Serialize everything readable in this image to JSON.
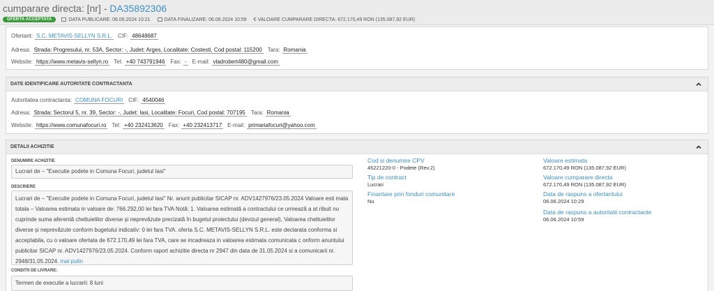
{
  "header": {
    "title_prefix": "cumparare directa: [nr] - ",
    "title_id": "DA35892306",
    "status_badge": "OFERTA ACCEPTATA",
    "publish_date": "DATA PUBLICARE: 06.06.2024 10:21",
    "finalize_date": "DATA FINALIZARE: 06.06.2024 10:59",
    "direct_value": "€ VALOARE CUMPARARE DIRECTA: 672.170,49  RON (135.087,92  EUR)"
  },
  "ofertant": {
    "name_label": "Ofertant:",
    "name": "S.C. METAVIS-SELLYN S.R.L.",
    "cif_label": "CIF:",
    "cif": "48648687",
    "address_label": "Adresa:",
    "address": "Strada: Progresului, nr. 53A, Sector: -, Judet: Arges, Localitate: Costesti, Cod postal: 115200",
    "country_label": "Tara:",
    "country": "Romania",
    "website_label": "Website:",
    "website": "https://www.metavis-sellyn.ro",
    "tel_label": "Tel:",
    "tel": "+40 743791946",
    "fax_label": "Fax:",
    "fax": "-",
    "email_label": "E-mail:",
    "email": "vladrobert480@gmail.com"
  },
  "autoritate": {
    "section_title": "DATE IDENTIFICARE AUTORITATE CONTRACTANTA",
    "name_label": "Autoritatea contractanta:",
    "name": "COMUNA FOCURI",
    "cif_label": "CIF:",
    "cif": "4540046",
    "address_label": "Adresa:",
    "address": "Strada: Sectorul 5, nr. 39, Sector: -, Judet: Iasi, Localitate: Focuri, Cod postal: 707195",
    "country_label": "Tara:",
    "country": "Romania",
    "website_label": "Website:",
    "website": "https://www.comunafocuri.ro",
    "tel_label": "Tel:",
    "tel": "+40 232413620",
    "fax_label": "Fax:",
    "fax": "+40 232413717",
    "email_label": "E-mail:",
    "email": "primariafocuri@yahoo.com"
  },
  "detalii": {
    "section_title": "DETALII ACHIZITIE",
    "denumire_label": "DENUMIRE ACHIZITIE",
    "denumire": "Lucrari de – \"Executie podete in Comuna Focuri, judetul Iasi\"",
    "descriere_label": "DESCRIERE",
    "descriere": "Lucrari de – \"Executie podete in Comuna Focuri, judetul Iasi\" Nr. anunt publicitar SICAP nr. ADV1427976/23.05.2024 Valoare esti mata totala – Valoarea estimata in valoare de: 766.292,00 lei fara TVA Notă: 1. Valoarea estimată a contractului ce urmează a at ribuit nu cuprinde suma aferentă cheltuielilor diverse și neprevăzute precizată în bugetul proiectului (devizul general), Valoarea cheltuielilor diverse și neprevăzute conform bugetului indicativ: 0 lei fara TVA. oferta S.C. METAVIS-SELLYN S.R.L. este declarata conforma si acceptabila, cu o valoare ofertata de 672.170,49 lei fara TVA, care se incadreaza in valoarea estimata comunicata c onform anuntului publicitar SICAP nr. ADV1427976/23.05.2024. Conform raport achizitie directa nr 2947 din data de 31.05.2024 si a comunicarii nr. 2948/31.05.2024.",
    "more_link": "mai putin",
    "conditii_label": "CONDITII DE LIVRARE:",
    "conditii": "Termen de executie a lucrarii: 8 luni",
    "cpv_label": "Cod si denumire CPV",
    "cpv": "45221220-0 - Podete (Rev.2)",
    "tip_label": "Tip de contract",
    "tip": "Lucrari",
    "fonduri_label": "Finantare prin fonduri comunitare",
    "fonduri": "Nu",
    "val_est_label": "Valoare estimata",
    "val_est": "672.170,49  RON (135.087,92  EUR)",
    "val_cump_label": "Valoare cumparare directa",
    "val_cump": "672.170,49  RON (135.087,92  EUR)",
    "raspuns_of_label": "Data de raspuns a ofertantului",
    "raspuns_of": "06.06.2024 10:29",
    "raspuns_aut_label": "Data de raspuns a autoritatii contractante",
    "raspuns_aut": "06.06.2024 10:59"
  }
}
